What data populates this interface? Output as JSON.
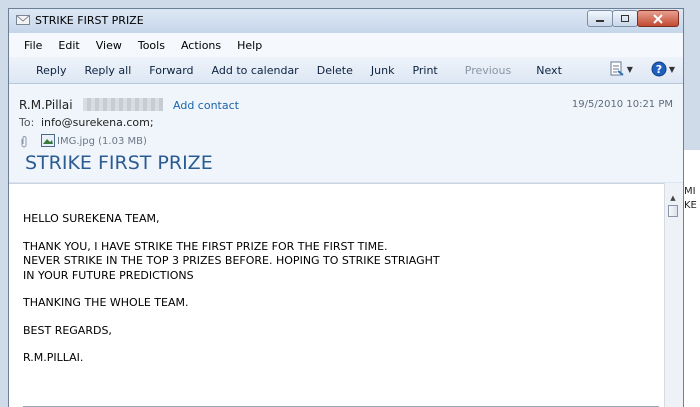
{
  "window": {
    "title": "STRIKE FIRST PRIZE"
  },
  "menu": [
    "File",
    "Edit",
    "View",
    "Tools",
    "Actions",
    "Help"
  ],
  "toolbar": {
    "reply": "Reply",
    "reply_all": "Reply all",
    "forward": "Forward",
    "add_to_calendar": "Add to calendar",
    "delete": "Delete",
    "junk": "Junk",
    "print": "Print",
    "previous": "Previous",
    "next": "Next"
  },
  "message": {
    "sender_name": "R.M.Pillai",
    "add_contact": "Add contact",
    "date": "19/5/2010 10:21 PM",
    "to_label": "To:",
    "to_value": "info@surekena.com;",
    "attachment": "IMG.jpg (1.03 MB)",
    "subject": "STRIKE FIRST PRIZE",
    "body": [
      "HELLO SUREKENA TEAM,",
      "THANK YOU, I HAVE STRIKE THE FIRST PRIZE FOR THE FIRST TIME.\nNEVER STRIKE IN THE TOP 3 PRIZES BEFORE. HOPING TO STRIKE STRIAGHT\nIN YOUR FUTURE PREDICTIONS",
      "THANKING THE WHOLE TEAM.",
      "BEST REGARDS,",
      "R.M.PILLAI."
    ]
  },
  "background": {
    "right_text_1": "MI",
    "right_text_2": "KE"
  },
  "colors": {
    "link": "#1a64b0",
    "subject": "#2b5b93",
    "close_button": "#c24a33"
  }
}
